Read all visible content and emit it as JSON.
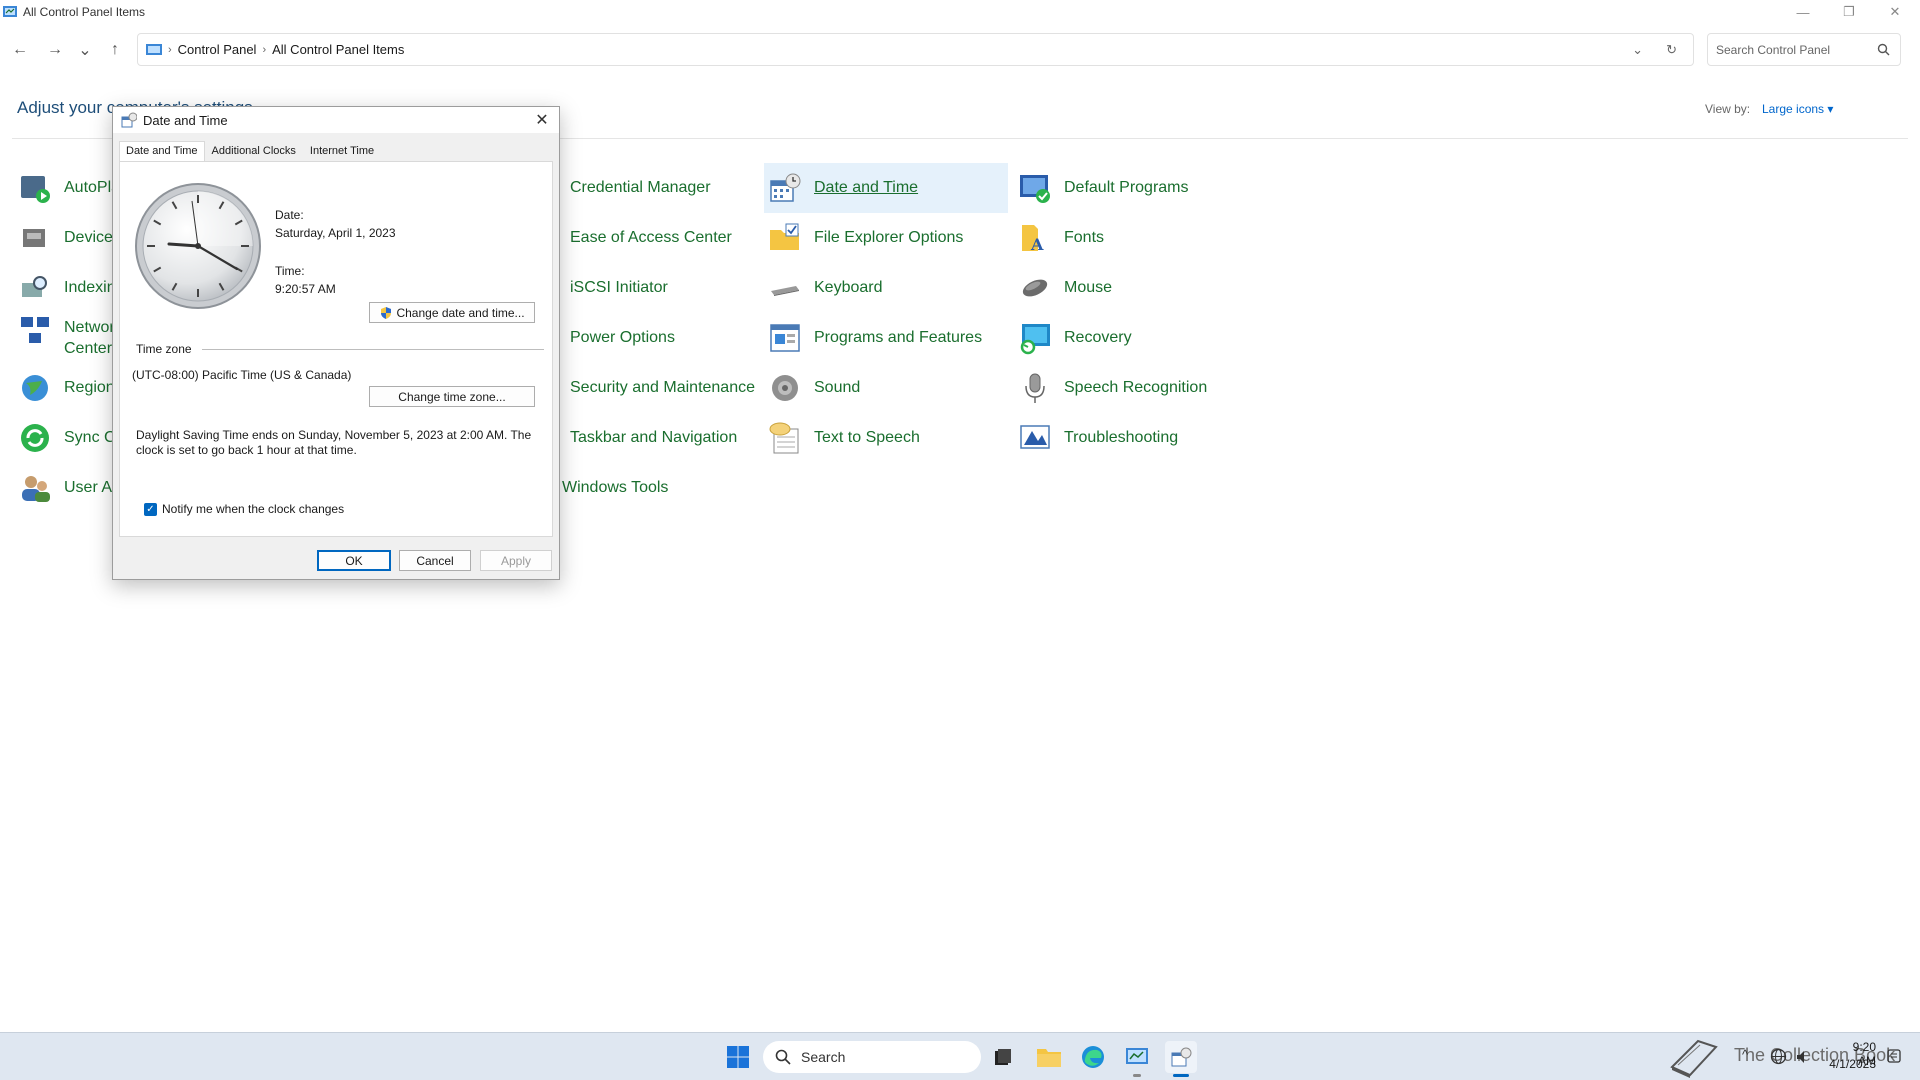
{
  "window": {
    "title": "All Control Panel Items",
    "minimize": "—",
    "restore": "❐",
    "close": "✕"
  },
  "nav": {
    "back": "←",
    "forward": "→",
    "recent": "⌄",
    "up": "↑",
    "breadcrumbs": [
      "Control Panel",
      "All Control Panel Items"
    ],
    "dropdown": "⌄",
    "refresh": "↻",
    "search_placeholder": "Search Control Panel"
  },
  "header": {
    "heading": "Adjust your computer's settings",
    "view_by_label": "View by:",
    "view_by_value": "Large icons ▾"
  },
  "items": {
    "col1": [
      "AutoPlay",
      "Device Manager",
      "Indexing Options",
      "Network and Sharing Center",
      "Region",
      "Sync Center",
      "User Accounts"
    ],
    "col2": [
      "Credential Manager",
      "Ease of Access Center",
      "iSCSI Initiator",
      "Power Options",
      "Security and Maintenance",
      "Taskbar and Navigation",
      "Windows Tools"
    ],
    "col3": [
      "Date and Time",
      "File Explorer Options",
      "Keyboard",
      "Programs and Features",
      "Sound",
      "Text to Speech"
    ],
    "col4": [
      "Default Programs",
      "Fonts",
      "Mouse",
      "Recovery",
      "Speech Recognition",
      "Troubleshooting"
    ]
  },
  "dialog": {
    "title": "Date and Time",
    "close": "✕",
    "tabs": [
      "Date and Time",
      "Additional Clocks",
      "Internet Time"
    ],
    "date_label": "Date:",
    "date_value": "Saturday, April 1, 2023",
    "time_label": "Time:",
    "time_value": "9:20:57 AM",
    "change_datetime": "Change date and time...",
    "tz_heading": "Time zone",
    "tz_value": "(UTC-08:00) Pacific Time (US & Canada)",
    "change_tz": "Change time zone...",
    "dst_line1": "Daylight Saving Time ends on Sunday, November 5, 2023 at 2:00 AM. The",
    "dst_line2": "clock is set to go back 1 hour at that time.",
    "notify_label": "Notify me when the clock changes",
    "notify_checked": true,
    "ok": "OK",
    "cancel": "Cancel",
    "apply": "Apply"
  },
  "taskbar": {
    "search": "Search",
    "tray_time": "9:20 AM",
    "tray_date": "4/1/2023",
    "watermark": "The Collection Book"
  }
}
